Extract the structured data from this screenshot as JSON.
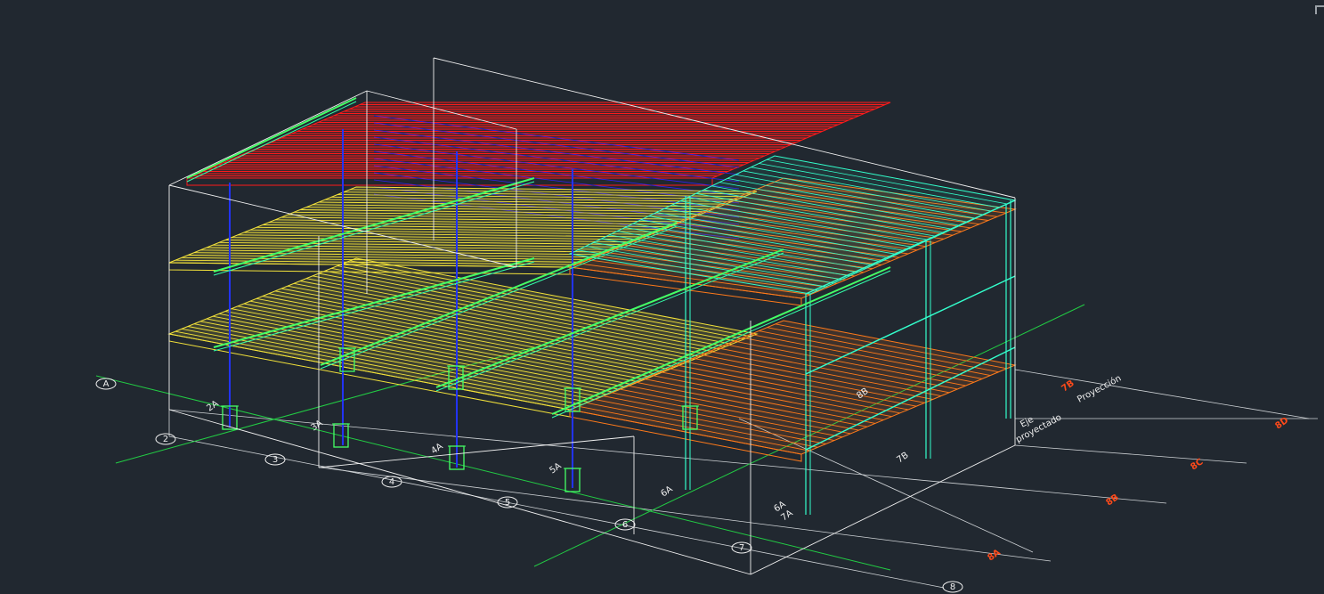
{
  "viewport": {
    "name": "3D wireframe structural model",
    "background": "#212830"
  },
  "colors": {
    "frame": "#f2f2f2",
    "slab_top": "#ff1a1a",
    "slab_mid": "#f3e23a",
    "slab_low": "#ff7a1a",
    "beam_cyan": "#33ffcc",
    "beam_green": "#44ff66",
    "column_blue": "#2233ff",
    "grid_green": "#22cc44",
    "label_orange": "#ff4a1a",
    "label_white": "#e8e8e8"
  },
  "grid_bubbles": [
    "A",
    "2",
    "3",
    "4",
    "5",
    "6",
    "7",
    "8"
  ],
  "grid_labels_white": [
    "2A",
    "3A",
    "4A",
    "5A",
    "6A",
    "6A",
    "7A",
    "7B",
    "8B"
  ],
  "grid_labels_orange": [
    "7B",
    "8D",
    "8C",
    "8B",
    "8A"
  ],
  "annotations": {
    "top_right": "Proyección",
    "right_mid": "Eje",
    "right_sub": "proyectado"
  }
}
